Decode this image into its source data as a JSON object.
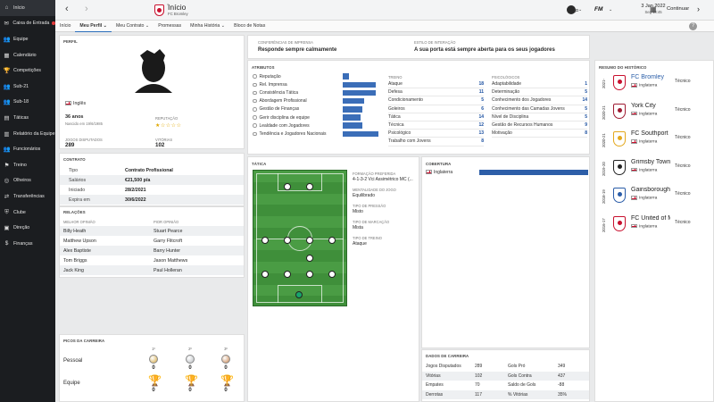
{
  "sidebar": {
    "items": [
      {
        "label": "Início",
        "icon": "home-icon",
        "glyph": "⌂"
      },
      {
        "label": "Caixa de Entrada",
        "icon": "inbox-icon",
        "glyph": "✉"
      },
      {
        "label": "Equipe",
        "icon": "team-icon",
        "glyph": "👥"
      },
      {
        "label": "Calendário",
        "icon": "calendar-icon",
        "glyph": "▦"
      },
      {
        "label": "Competições",
        "icon": "trophy-icon",
        "glyph": "🏆"
      },
      {
        "label": "Sub-21",
        "icon": "u21-icon",
        "glyph": "👥"
      },
      {
        "label": "Sub-18",
        "icon": "u18-icon",
        "glyph": "👥"
      },
      {
        "label": "Táticas",
        "icon": "tactics-icon",
        "glyph": "▤"
      },
      {
        "label": "Relatório da Equipe",
        "icon": "report-icon",
        "glyph": "▥"
      },
      {
        "label": "Funcionários",
        "icon": "staff-icon",
        "glyph": "👥"
      },
      {
        "label": "Treino",
        "icon": "training-icon",
        "glyph": "⚑"
      },
      {
        "label": "Olheiros",
        "icon": "scouting-icon",
        "glyph": "◎"
      },
      {
        "label": "Transferências",
        "icon": "transfers-icon",
        "glyph": "⇄"
      },
      {
        "label": "Clube",
        "icon": "club-icon",
        "glyph": "⛨"
      },
      {
        "label": "Direção",
        "icon": "board-icon",
        "glyph": "▣"
      },
      {
        "label": "Finanças",
        "icon": "finances-icon",
        "glyph": "$"
      }
    ]
  },
  "topbar": {
    "title": "Início",
    "subtitle": "FC Bromley",
    "fm_label": "FM",
    "date": "3 Jan 2022",
    "time": "Seg 18:45",
    "continue_label": "Continuar",
    "help": "?"
  },
  "tabs": [
    {
      "label": "Início"
    },
    {
      "label": "Meu Perfil ⌄"
    },
    {
      "label": "Meu Contrato ⌄"
    },
    {
      "label": "Promessas"
    },
    {
      "label": "Minha História ⌄"
    },
    {
      "label": "Bloco de Notas"
    }
  ],
  "profile": {
    "section": "PERFIL",
    "nationality": "Inglês",
    "age": "36 anos",
    "born": "Nascido em 19/6/1985",
    "reputation_label": "REPUTAÇÃO",
    "reputation_stars": "★☆☆☆☆",
    "games_label": "JOGOS DISPUTADOS",
    "games": "289",
    "wins_label": "VITÓRIAS",
    "wins": "102"
  },
  "contract": {
    "section": "CONTRATO",
    "rows": [
      {
        "k": "Tipo",
        "v": "Contrato Profissional"
      },
      {
        "k": "Salários",
        "v": "€21,500 p/a"
      },
      {
        "k": "Iniciado",
        "v": "28/2/2021"
      },
      {
        "k": "Expira em",
        "v": "30/6/2022"
      }
    ]
  },
  "relations": {
    "section": "RELAÇÕES",
    "best_label": "MELHOR OPINIÃO",
    "worst_label": "PIOR OPINIÃO",
    "rows": [
      {
        "best": "Billy Heath",
        "worst": "Stuart Pearce"
      },
      {
        "best": "Matthew Upson",
        "worst": "Garry Flitcroft"
      },
      {
        "best": "Alex Baptiste",
        "worst": "Barry Hunter"
      },
      {
        "best": "Tom Briggs",
        "worst": "Jason Matthews"
      },
      {
        "best": "Jack King",
        "worst": "Paul Holleran"
      }
    ]
  },
  "career_highs": {
    "section": "PICOS DA CARREIRA",
    "headers": [
      "1º",
      "2º",
      "3º"
    ],
    "rows": [
      {
        "label": "Pessoal",
        "values": [
          "0",
          "0",
          "0"
        ]
      },
      {
        "label": "Equipe",
        "values": [
          "0",
          "0",
          "0"
        ]
      }
    ]
  },
  "press": {
    "label": "CONFERÊNCIAS DE IMPRENSA",
    "value": "Responde sempre calmamente"
  },
  "interaction": {
    "label": "ESTILO DE INTERAÇÃO",
    "value": "A sua porta está sempre aberta para os seus jogadores"
  },
  "attributes": {
    "section": "ATRIBUTOS",
    "items": [
      {
        "label": "Reputação",
        "level": 0.15
      },
      {
        "label": "Rel. Imprensa",
        "level": 0.85
      },
      {
        "label": "Consistência Tática",
        "level": 0.85
      },
      {
        "label": "Abordagem Profissional",
        "level": 0.55
      },
      {
        "label": "Gestão de Finanças",
        "level": 0.5
      },
      {
        "label": "Gerir disciplina de equipe",
        "level": 0.45
      },
      {
        "label": "Lealdade com Jogadores",
        "level": 0.5
      },
      {
        "label": "Tendência e Jogadores Nacionais",
        "level": 0.9
      }
    ],
    "training_label": "TREINO",
    "training": [
      {
        "k": "Ataque",
        "v": "18"
      },
      {
        "k": "Defesa",
        "v": "11"
      },
      {
        "k": "Condicionamento",
        "v": "5"
      },
      {
        "k": "Goleiros",
        "v": "6"
      },
      {
        "k": "Tática",
        "v": "14"
      },
      {
        "k": "Técnica",
        "v": "12"
      },
      {
        "k": "Psicológico",
        "v": "13"
      },
      {
        "k": "Trabalho com Jovens",
        "v": "8"
      }
    ],
    "psych_label": "PSICOLÓGICOS",
    "psych": [
      {
        "k": "Adaptabilidade",
        "v": "1"
      },
      {
        "k": "Determinação",
        "v": "5"
      },
      {
        "k": "Conhecimento dos Jogadores",
        "v": "14"
      },
      {
        "k": "Conhecimento das Camadas Jovens",
        "v": "5"
      },
      {
        "k": "Nível de Disciplina",
        "v": "5"
      },
      {
        "k": "Gestão de Recursos Humanos",
        "v": "9"
      },
      {
        "k": "Motivação",
        "v": "8"
      }
    ]
  },
  "tactics": {
    "section": "TÁTICA",
    "formation_label": "FORMAÇÃO PREFERIDA",
    "formation": "4-1-3-2 Vci Assimétrico MC (...",
    "mentality_label": "MENTALIDADE DO JOGO",
    "mentality": "Equilibrado",
    "press_label": "TIPO DE PRESSÃO",
    "press": "Misto",
    "marking_label": "TIPO DE MARCAÇÃO",
    "marking": "Mista",
    "tackle_label": "TIPO DE TREINO",
    "tackle": "Ataque"
  },
  "coverage": {
    "section": "COBERTURA",
    "country": "Inglaterra",
    "level": 1.0
  },
  "history": {
    "section": "RESUMO DO HISTÓRICO",
    "rows": [
      {
        "year": "2021-",
        "club": "FC Bromley",
        "nation": "Inglaterra",
        "role": "Técnico",
        "highlight": true,
        "color": "#c8102e"
      },
      {
        "year": "2020-21",
        "club": "York City",
        "nation": "Inglaterra",
        "role": "Técnico",
        "highlight": false,
        "color": "#9e1b32"
      },
      {
        "year": "2020-21",
        "club": "FC Southport",
        "nation": "Inglaterra",
        "role": "Técnico",
        "highlight": false,
        "color": "#e3a81d"
      },
      {
        "year": "2019-20",
        "club": "Grimsby Town",
        "nation": "Inglaterra",
        "role": "Técnico",
        "highlight": false,
        "color": "#222"
      },
      {
        "year": "2018-19",
        "club": "Gainsborough T...",
        "nation": "Inglaterra",
        "role": "Técnico",
        "highlight": false,
        "color": "#2a5ca8"
      },
      {
        "year": "2016-17",
        "club": "FC United of M...",
        "nation": "Inglaterra",
        "role": "Técnico",
        "highlight": false,
        "color": "#c8102e"
      }
    ]
  },
  "career_stats": {
    "section": "DADOS DE CARREIRA",
    "rows": [
      {
        "k1": "Jogos Disputados",
        "v1": "289",
        "k2": "Gols Pró",
        "v2": "349"
      },
      {
        "k1": "Vitórias",
        "v1": "102",
        "k2": "Gols Contra",
        "v2": "437"
      },
      {
        "k1": "Empates",
        "v1": "70",
        "k2": "Saldo de Gols",
        "v2": "-88"
      },
      {
        "k1": "Derrotas",
        "v1": "117",
        "k2": "% Vitórias",
        "v2": "35%"
      }
    ]
  }
}
